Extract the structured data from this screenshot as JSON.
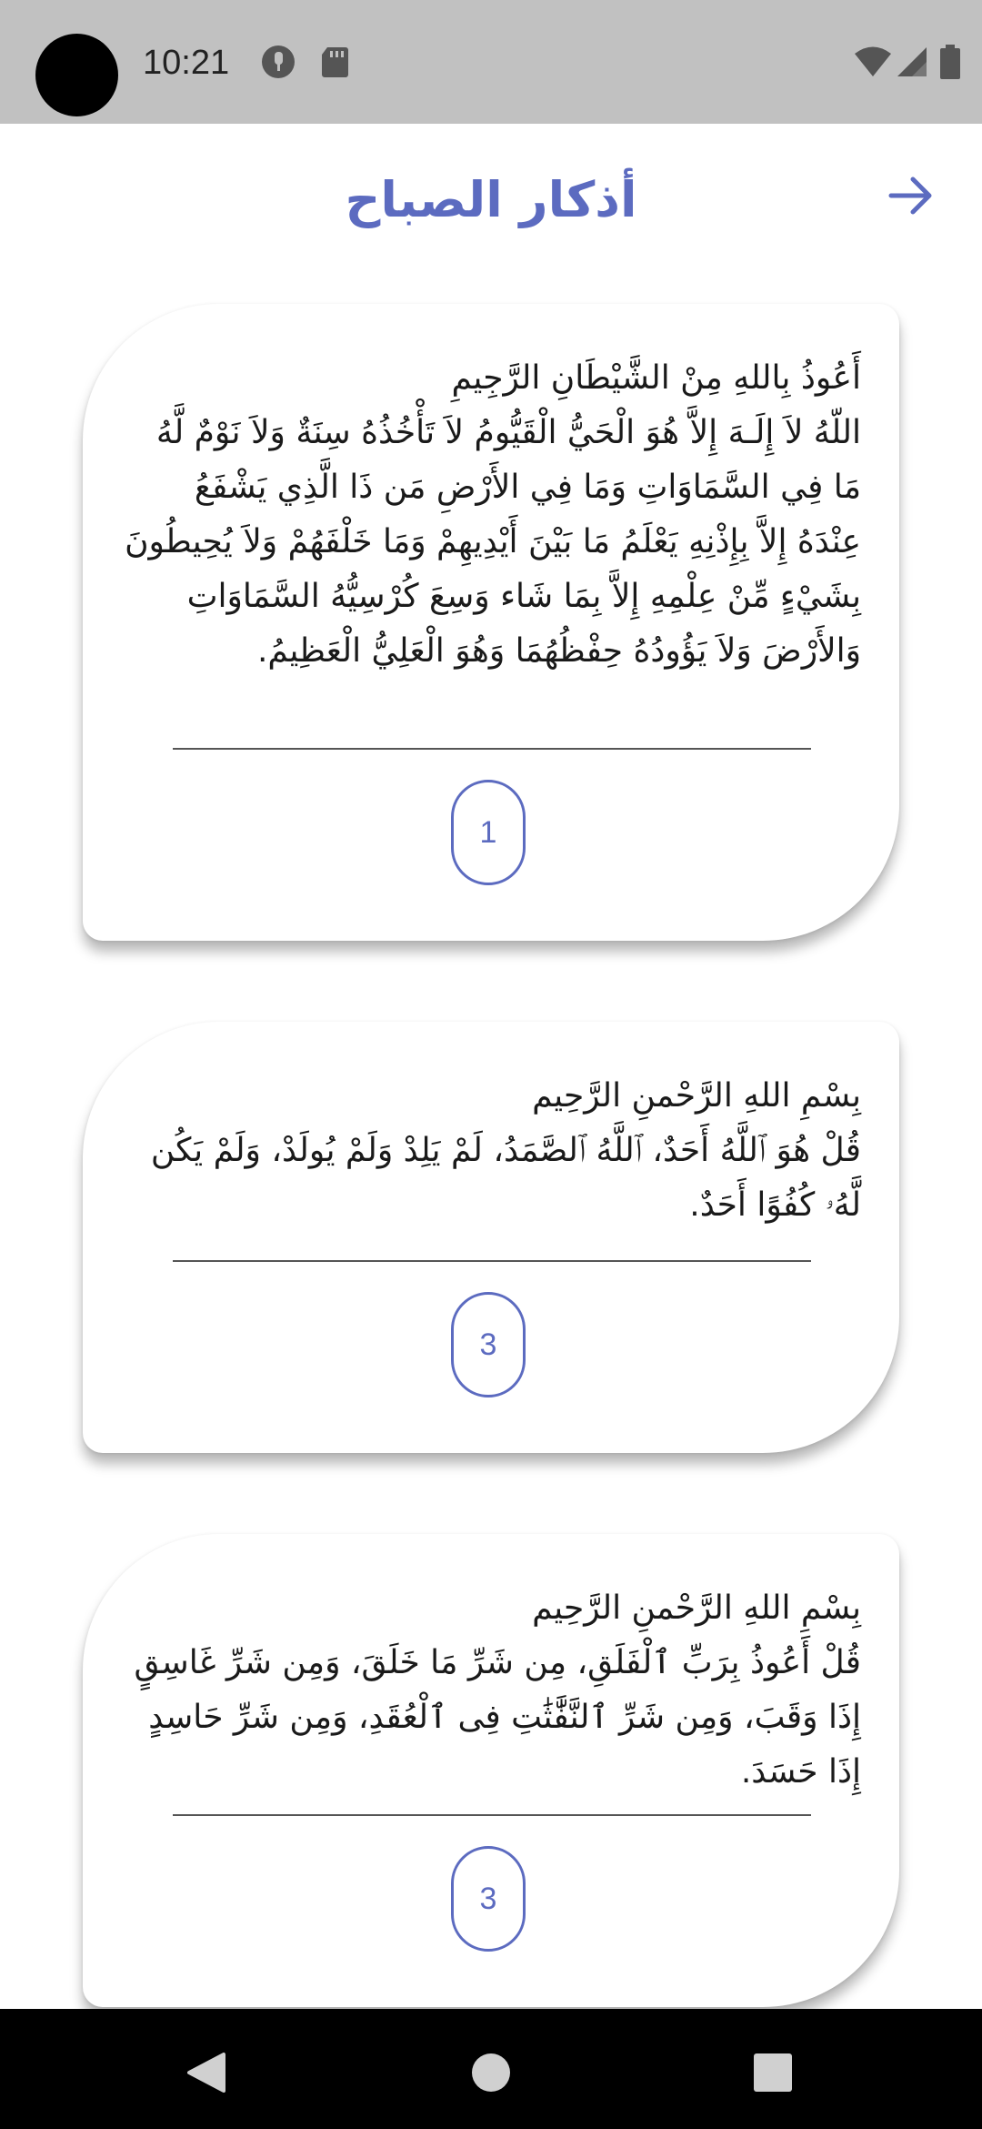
{
  "status_bar": {
    "time": "10:21"
  },
  "header": {
    "title": "أذكار الصباح"
  },
  "cards": [
    {
      "text": "أَعُوذُ بِاللهِ مِنْ الشَّيْطَانِ الرَّجِيمِ\nاللّهُ لاَ إِلَـهَ إِلاَّ هُوَ الْحَيُّ الْقَيُّومُ لاَ تَأْخُذُهُ سِنَةٌ وَلاَ نَوْمٌ لَّهُ مَا فِي السَّمَاوَاتِ وَمَا فِي الأَرْضِ مَن ذَا الَّذِي يَشْفَعُ عِنْدَهُ إِلاَّ بِإِذْنِهِ يَعْلَمُ مَا بَيْنَ أَيْدِيهِمْ وَمَا خَلْفَهُمْ وَلاَ يُحِيطُونَ بِشَيْءٍ مِّنْ عِلْمِهِ إِلاَّ بِمَا شَاء وَسِعَ كُرْسِيُّهُ السَّمَاوَاتِ وَالأَرْضَ وَلاَ يَؤُودُهُ حِفْظُهُمَا وَهُوَ الْعَلِيُّ الْعَظِيمُ.",
      "count": "1"
    },
    {
      "text": "بِسْمِ اللهِ الرَّحْمنِ الرَّحِيم\nقُلْ هُوَ ٱللَّهُ أَحَدٌ، ٱللَّهُ ٱلصَّمَدُ، لَمْ يَلِدْ وَلَمْ يُولَدْ، وَلَمْ يَكُن لَّهُۥ كُفُوًا أَحَدٌ.",
      "count": "3"
    },
    {
      "text": "بِسْمِ اللهِ الرَّحْمنِ الرَّحِيم\nقُلْ أَعُوذُ بِرَبِّ ٱلْفَلَقِ، مِن شَرِّ مَا خَلَقَ، وَمِن شَرِّ غَاسِقٍ إِذَا وَقَبَ، وَمِن شَرِّ ٱلنَّفَّٰثَٰتِ فِى ٱلْعُقَدِ، وَمِن شَرِّ حَاسِدٍ إِذَا حَسَدَ.",
      "count": "3"
    }
  ],
  "colors": {
    "accent": "#5c6bc0",
    "status_bar_bg": "#c1c1c1",
    "nav_bar_bg": "#000000"
  },
  "icons": {
    "status": [
      "data-saver-icon",
      "sd-card-icon",
      "wifi-icon",
      "signal-icon",
      "battery-icon"
    ],
    "header": "arrow-forward-icon",
    "nav": [
      "back-nav-icon",
      "home-nav-icon",
      "recents-nav-icon"
    ]
  }
}
